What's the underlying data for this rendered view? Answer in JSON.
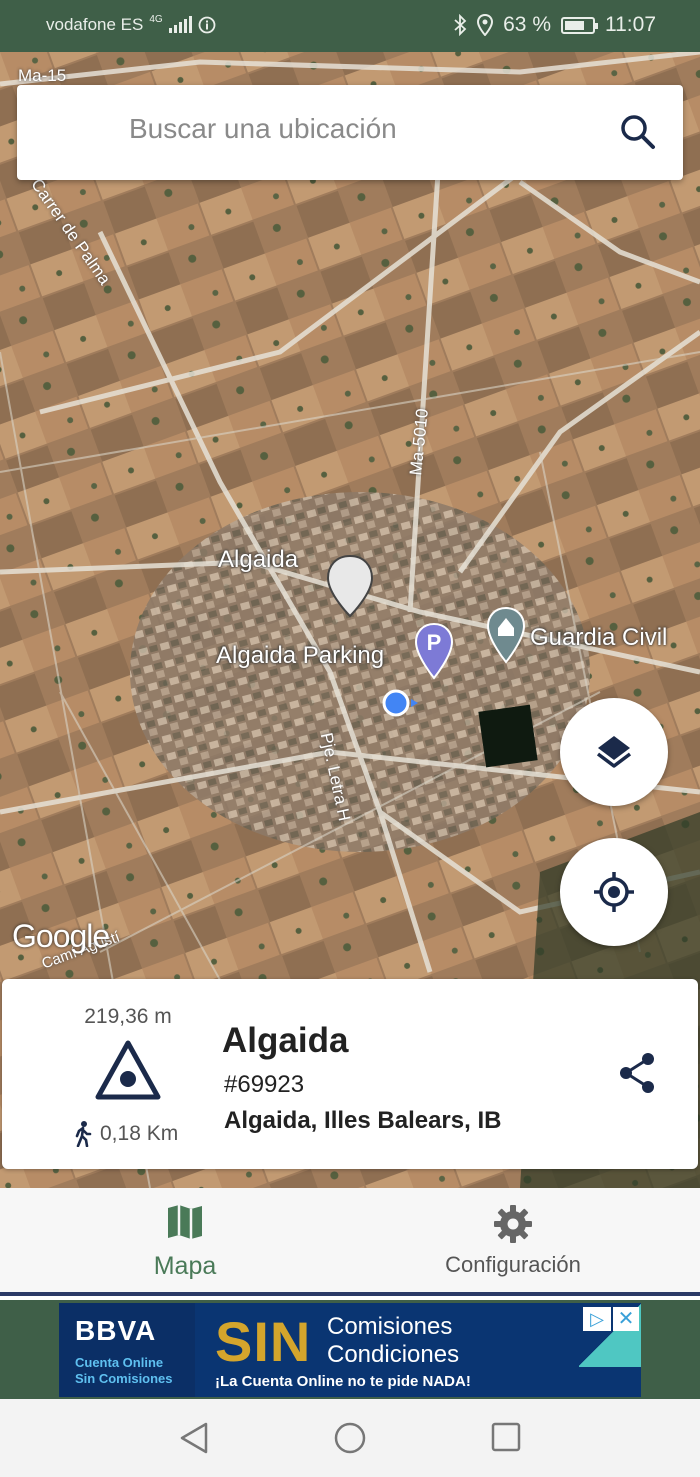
{
  "status_bar": {
    "carrier": "vodafone ES",
    "network": "4G",
    "battery_percent": "63 %",
    "battery_level": 0.63,
    "time": "11:07",
    "icons": [
      "signal-icon",
      "info-icon",
      "bluetooth-icon",
      "location-icon",
      "battery-icon"
    ]
  },
  "search": {
    "placeholder": "Buscar una ubicación"
  },
  "map": {
    "labels": {
      "town": "Algaida",
      "parking": "Algaida Parking",
      "police": "Guardia Civil",
      "road_ma15": "Ma-15",
      "road_ma5010": "Ma-5010",
      "street_palma": "Carrer de Palma",
      "street_letra": "Pje. Letra H",
      "street_agusti": "Camí Agustí",
      "google": "Google"
    }
  },
  "card": {
    "elevation": "219,36 m",
    "distance": "0,18 Km",
    "name": "Algaida",
    "id": "#69923",
    "region": "Algaida, Illes Balears, IB"
  },
  "bottom_nav": {
    "map_label": "Mapa",
    "settings_label": "Configuración"
  },
  "ad": {
    "brand": "BBVA",
    "sub1": "Cuenta Online",
    "sub2": "Sin Comisiones",
    "big": "SIN",
    "line1": "Comisiones",
    "line2": "Condiciones",
    "tagline": "¡La Cuenta Online no te pide NADA!"
  },
  "colors": {
    "status_bar": "#3f5f48",
    "accent": "#4a7a58",
    "location_dot": "#4285f4"
  }
}
